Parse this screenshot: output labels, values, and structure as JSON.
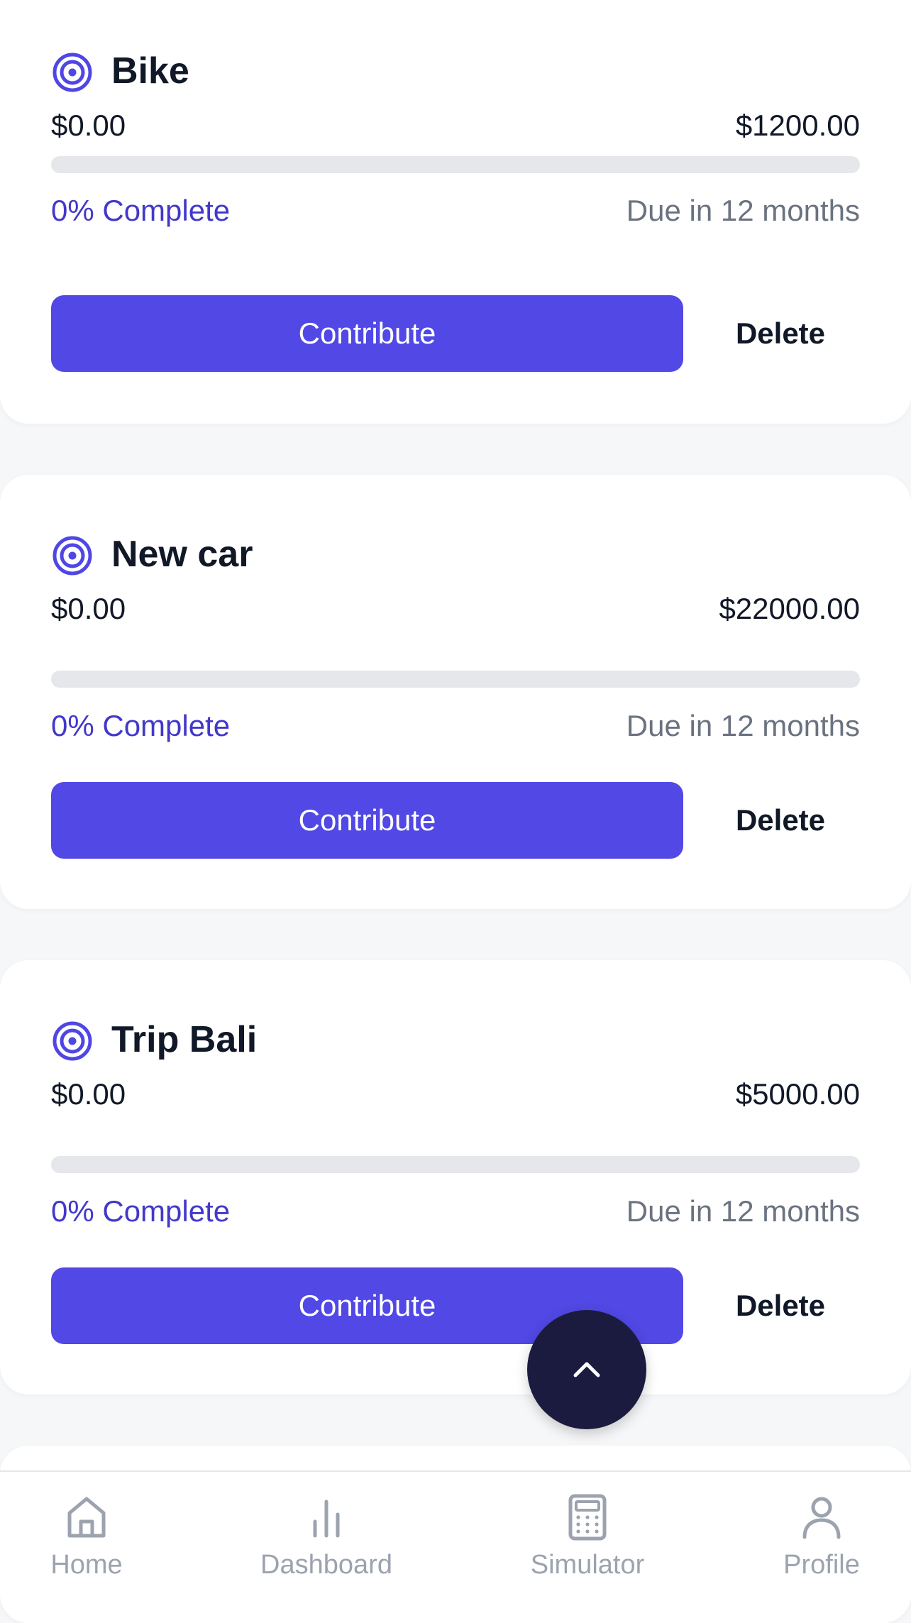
{
  "goals": [
    {
      "title": "Bike",
      "current": "$0.00",
      "target": "$1200.00",
      "progress_percent": 0,
      "percent_label": "0% Complete",
      "due_label": "Due in 12 months",
      "contribute_label": "Contribute",
      "delete_label": "Delete"
    },
    {
      "title": "New car",
      "current": "$0.00",
      "target": "$22000.00",
      "progress_percent": 0,
      "percent_label": "0% Complete",
      "due_label": "Due in 12 months",
      "contribute_label": "Contribute",
      "delete_label": "Delete"
    },
    {
      "title": "Trip Bali",
      "current": "$0.00",
      "target": "$5000.00",
      "progress_percent": 0,
      "percent_label": "0% Complete",
      "due_label": "Due in 12 months",
      "contribute_label": "Contribute",
      "delete_label": "Delete"
    }
  ],
  "fab": {
    "icon": "chevron-up-icon"
  },
  "nav": {
    "items": [
      {
        "label": "Home",
        "icon": "home-icon"
      },
      {
        "label": "Dashboard",
        "icon": "bar-chart-icon"
      },
      {
        "label": "Simulator",
        "icon": "calculator-icon"
      },
      {
        "label": "Profile",
        "icon": "user-icon"
      }
    ]
  },
  "colors": {
    "accent": "#5148e5",
    "accent_text": "#4338ca",
    "fab_background": "#1b1b3f",
    "track": "#e5e7eb",
    "muted_text": "#6b7280",
    "nav_inactive": "#9ca3af"
  }
}
